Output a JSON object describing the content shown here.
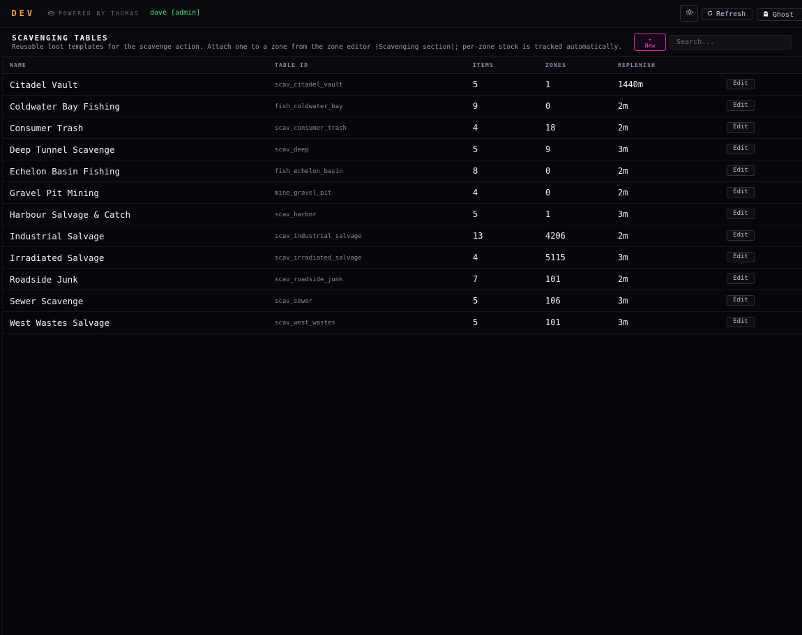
{
  "topbar": {
    "brand": "/ DEV",
    "powered_by": "POWERED BY THOMAS",
    "user": "dave [admin]",
    "refresh_label": "Refresh",
    "ghost_label": "Ghost"
  },
  "section": {
    "title": "SCAVENGING TABLES",
    "description": "Reusable loot templates for the scavenge action. Attach one to a zone from the zone editor (Scavenging section); per-zone stock is tracked automatically.",
    "new_label_plus": "+",
    "new_label": "New",
    "search_placeholder": "Search..."
  },
  "table": {
    "columns": {
      "name": "NAME",
      "table_id": "TABLE ID",
      "items": "ITEMS",
      "zones": "ZONES",
      "replenish": "REPLENISH"
    },
    "edit_label": "Edit",
    "rows": [
      {
        "name": "Citadel Vault",
        "table_id": "scav_citadel_vault",
        "items": "5",
        "zones": "1",
        "replenish": "1440m"
      },
      {
        "name": "Coldwater Bay Fishing",
        "table_id": "fish_coldwater_bay",
        "items": "9",
        "zones": "0",
        "replenish": "2m"
      },
      {
        "name": "Consumer Trash",
        "table_id": "scav_consumer_trash",
        "items": "4",
        "zones": "18",
        "replenish": "2m"
      },
      {
        "name": "Deep Tunnel Scavenge",
        "table_id": "scav_deep",
        "items": "5",
        "zones": "9",
        "replenish": "3m"
      },
      {
        "name": "Echelon Basin Fishing",
        "table_id": "fish_echelon_basin",
        "items": "8",
        "zones": "0",
        "replenish": "2m"
      },
      {
        "name": "Gravel Pit Mining",
        "table_id": "mine_gravel_pit",
        "items": "4",
        "zones": "0",
        "replenish": "2m"
      },
      {
        "name": "Harbour Salvage & Catch",
        "table_id": "scav_harbor",
        "items": "5",
        "zones": "1",
        "replenish": "3m"
      },
      {
        "name": "Industrial Salvage",
        "table_id": "scav_industrial_salvage",
        "items": "13",
        "zones": "4206",
        "replenish": "2m"
      },
      {
        "name": "Irradiated Salvage",
        "table_id": "scav_irradiated_salvage",
        "items": "4",
        "zones": "5115",
        "replenish": "3m"
      },
      {
        "name": "Roadside Junk",
        "table_id": "scav_roadside_junk",
        "items": "7",
        "zones": "101",
        "replenish": "2m"
      },
      {
        "name": "Sewer Scavenge",
        "table_id": "scav_sewer",
        "items": "5",
        "zones": "106",
        "replenish": "3m"
      },
      {
        "name": "West Wastes Salvage",
        "table_id": "scav_west_wastes",
        "items": "5",
        "zones": "101",
        "replenish": "3m"
      }
    ]
  }
}
